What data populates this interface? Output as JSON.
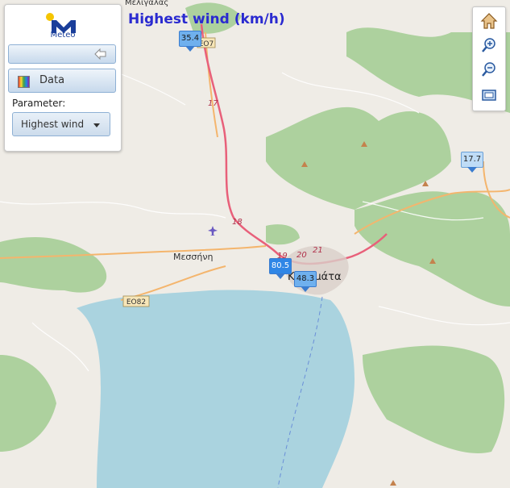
{
  "map": {
    "title": "Highest wind (km/h)",
    "place_labels": {
      "top": "Μελιγαλάς",
      "messini": "Μεσσήνη",
      "kalamata": "Καλαμάτα"
    },
    "road_refs": {
      "eo7": "EO7",
      "eo82": "EO82",
      "r17": "17",
      "r18": "18",
      "r19": "19",
      "r20": "20",
      "r21": "21"
    },
    "colors": {
      "sea": "#aad3df",
      "forest": "#add19e",
      "land": "#efece6",
      "primary_road": "#e8607a",
      "secondary_road": "#f4b56d",
      "title": "#2a2ad0",
      "marker": "#6fb0ee"
    }
  },
  "panel": {
    "logo_text": "Meteo",
    "data_button": "Data",
    "parameter_label": "Parameter:",
    "parameter_value": "Highest wind"
  },
  "toolbar": {
    "items": [
      "home-icon",
      "zoom-in-icon",
      "zoom-out-icon",
      "zoom-extent-icon"
    ]
  },
  "markers": [
    {
      "value": "35.4"
    },
    {
      "value": "17.7"
    },
    {
      "value": "80.5"
    },
    {
      "value": "48.3"
    }
  ]
}
